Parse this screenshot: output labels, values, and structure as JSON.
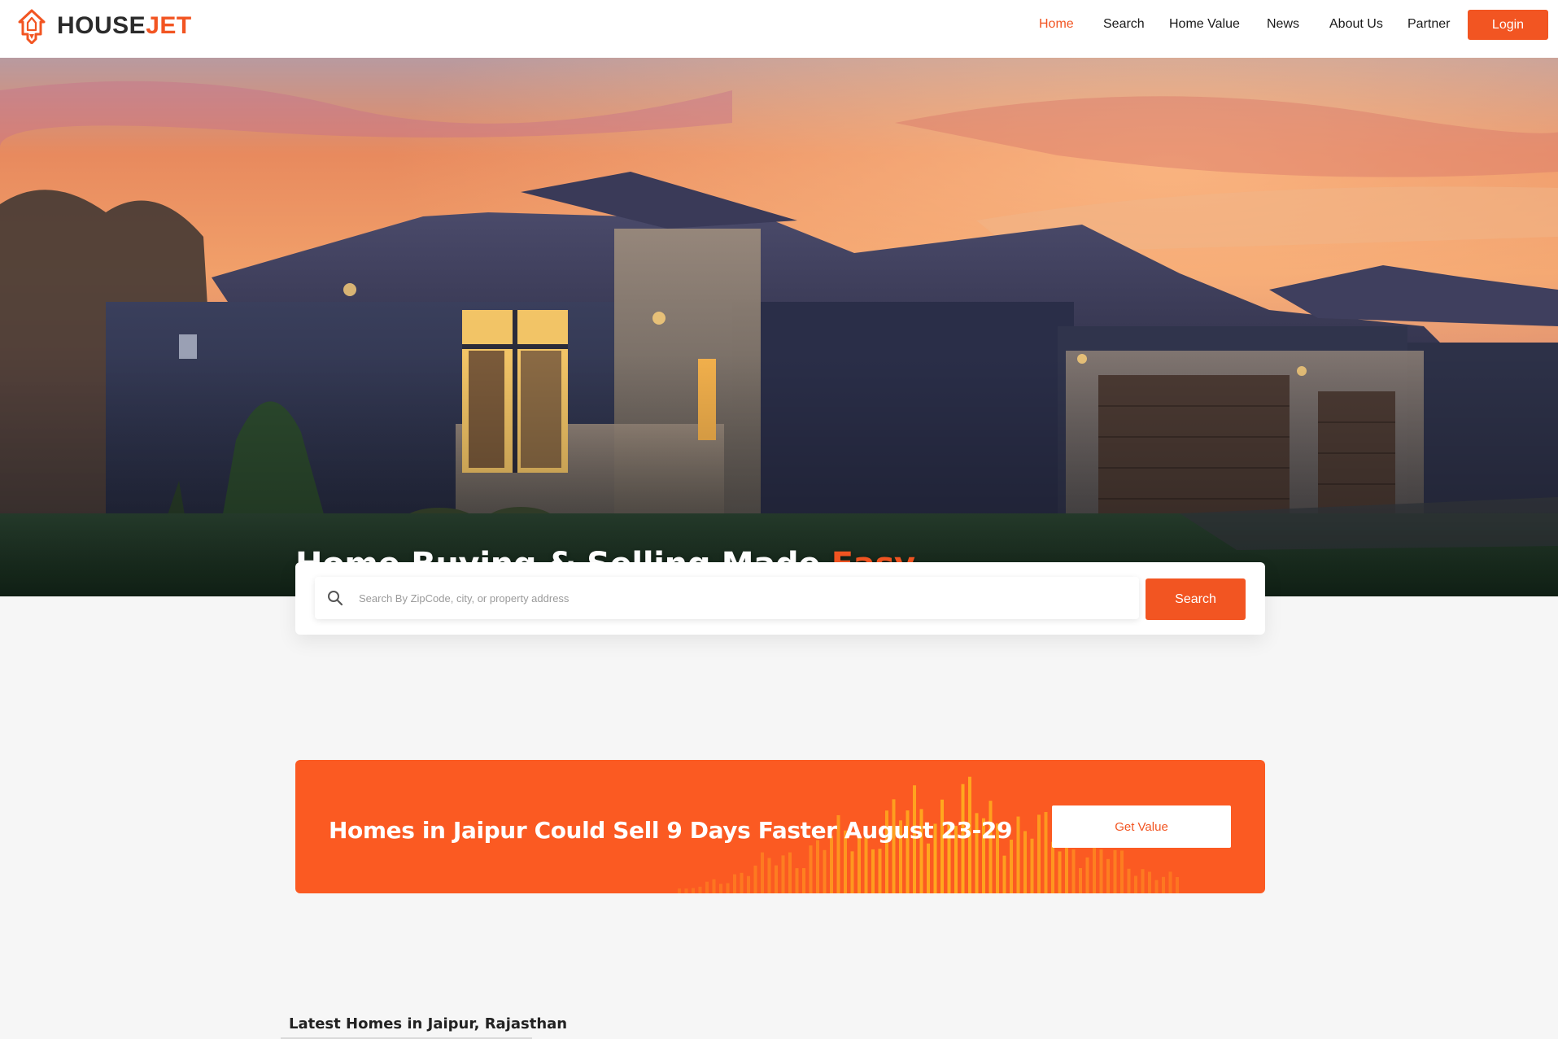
{
  "brand": {
    "name_part1": "HOUSE",
    "name_part2": "JET",
    "accent_color": "#f25522"
  },
  "nav": {
    "items": [
      {
        "label": "Home",
        "active": true
      },
      {
        "label": "Search",
        "active": false
      },
      {
        "label": "Home Value",
        "active": false
      },
      {
        "label": "News",
        "active": false
      },
      {
        "label": "About Us",
        "active": false
      },
      {
        "label": "Partner",
        "active": false
      }
    ],
    "login_label": "Login"
  },
  "hero": {
    "title_main": "Home Buying & Selling Made ",
    "title_accent": "Easy",
    "image_icon": "house-photo"
  },
  "search": {
    "placeholder": "Search By ZipCode, city, or property address",
    "value": "",
    "button_label": "Search",
    "icon": "search-icon"
  },
  "promo": {
    "text": "Homes in Jaipur Could Sell 9 Days Faster August 23-29",
    "button_label": "Get Value",
    "background_color": "#fb5a22"
  },
  "latest": {
    "heading": "Latest Homes in Jaipur, Rajasthan"
  }
}
